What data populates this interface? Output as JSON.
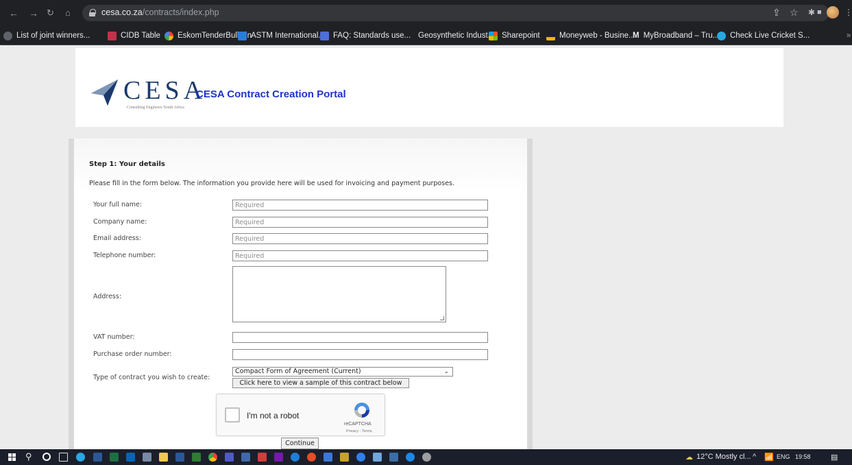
{
  "browser": {
    "url_host": "cesa.co.za",
    "url_path": "/contracts/index.php",
    "bookmarks": [
      {
        "label": "List of joint winners...",
        "color": "#9aa0a6"
      },
      {
        "label": "CIDB Table",
        "color": "#c4314b"
      },
      {
        "label": "EskomTenderBulletin",
        "color": "#f4b400"
      },
      {
        "label": "ASTM International...",
        "color": "#2b7bd8"
      },
      {
        "label": "FAQ: Standards use...",
        "color": "#4f6fd8"
      },
      {
        "label": "Geosynthetic Indust...",
        "color": ""
      },
      {
        "label": "Sharepoint",
        "color": "#f25022"
      },
      {
        "label": "Moneyweb - Busine...",
        "color": "#f2b600"
      },
      {
        "label": "MyBroadband – Tru...",
        "color": ""
      },
      {
        "label": "Check Live Cricket S...",
        "color": "#29a7e1"
      }
    ],
    "mybroadband_badge": "M",
    "more": "»"
  },
  "header": {
    "logo_text": "CESA",
    "logo_subtitle": "Consulting Engineers South Africa",
    "portal_title": "CESA Contract Creation Portal"
  },
  "form": {
    "step_title": "Step 1: Your details",
    "intro": "Please fill in the form below. The information you provide here will be used for invoicing and payment purposes.",
    "fields": [
      {
        "label": "Your full name:",
        "value": "Required"
      },
      {
        "label": "Company name:",
        "value": "Required"
      },
      {
        "label": "Email address:",
        "value": "Required"
      },
      {
        "label": "Telephone number:",
        "value": "Required"
      }
    ],
    "address_label": "Address:",
    "vat_label": "VAT number:",
    "vat_value": "",
    "po_label": "Purchase order number:",
    "po_value": "",
    "contract_label": "Type of contract you wish to create:",
    "contract_selected": "Compact Form of Agreement (Current)",
    "sample_button": "Click here to view a sample of this contract below",
    "continue_button": "Continue"
  },
  "recaptcha": {
    "label": "I'm not a robot",
    "brand": "reCAPTCHA",
    "terms": "Privacy - Terms"
  },
  "taskbar": {
    "weather": "12°C Mostly cl...",
    "language": "ENG",
    "time": "19:58"
  }
}
